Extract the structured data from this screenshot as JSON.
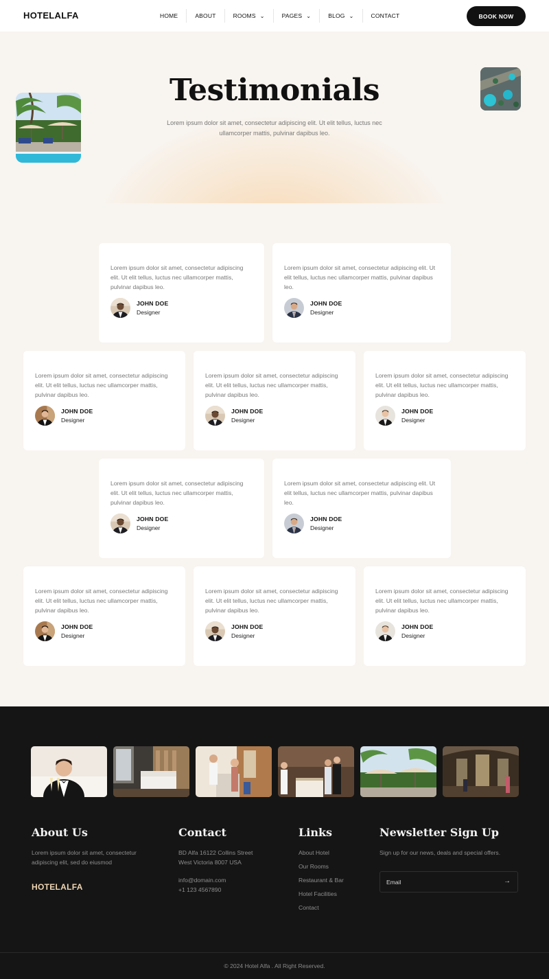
{
  "header": {
    "logo": "HOTELALFA",
    "nav": [
      {
        "label": "HOME",
        "dropdown": false
      },
      {
        "label": "ABOUT",
        "dropdown": false
      },
      {
        "label": "ROOMS",
        "dropdown": true
      },
      {
        "label": "PAGES",
        "dropdown": true
      },
      {
        "label": "BLOG",
        "dropdown": true
      },
      {
        "label": "CONTACT",
        "dropdown": false
      }
    ],
    "book_button": "BOOK NOW"
  },
  "hero": {
    "title": "Testimonials",
    "subtitle": "Lorem ipsum dolor sit amet, consectetur adipiscing elit. Ut elit tellus, luctus nec ullamcorper mattis, pulvinar dapibus leo."
  },
  "testimonials": [
    {
      "text": "Lorem ipsum dolor sit amet, consectetur adipiscing elit. Ut elit tellus, luctus nec ullamcorper mattis, pulvinar dapibus leo.",
      "name": "JOHN DOE",
      "role": "Designer"
    },
    {
      "text": "Lorem ipsum dolor sit amet, consectetur adipiscing elit. Ut elit tellus, luctus nec ullamcorper mattis, pulvinar dapibus leo.",
      "name": "JOHN DOE",
      "role": "Designer"
    },
    {
      "text": "Lorem ipsum dolor sit amet, consectetur adipiscing elit. Ut elit tellus, luctus nec ullamcorper mattis, pulvinar dapibus leo.",
      "name": "JOHN DOE",
      "role": "Designer"
    },
    {
      "text": "Lorem ipsum dolor sit amet, consectetur adipiscing elit. Ut elit tellus, luctus nec ullamcorper mattis, pulvinar dapibus leo.",
      "name": "JOHN DOE",
      "role": "Designer"
    },
    {
      "text": "Lorem ipsum dolor sit amet, consectetur adipiscing elit. Ut elit tellus, luctus nec ullamcorper mattis, pulvinar dapibus leo.",
      "name": "JOHN DOE",
      "role": "Designer"
    },
    {
      "text": "Lorem ipsum dolor sit amet, consectetur adipiscing elit. Ut elit tellus, luctus nec ullamcorper mattis, pulvinar dapibus leo.",
      "name": "JOHN DOE",
      "role": "Designer"
    },
    {
      "text": "Lorem ipsum dolor sit amet, consectetur adipiscing elit. Ut elit tellus, luctus nec ullamcorper mattis, pulvinar dapibus leo.",
      "name": "JOHN DOE",
      "role": "Designer"
    },
    {
      "text": "Lorem ipsum dolor sit amet, consectetur adipiscing elit. Ut elit tellus, luctus nec ullamcorper mattis, pulvinar dapibus leo.",
      "name": "JOHN DOE",
      "role": "Designer"
    },
    {
      "text": "Lorem ipsum dolor sit amet, consectetur adipiscing elit. Ut elit tellus, luctus nec ullamcorper mattis, pulvinar dapibus leo.",
      "name": "JOHN DOE",
      "role": "Designer"
    },
    {
      "text": "Lorem ipsum dolor sit amet, consectetur adipiscing elit. Ut elit tellus, luctus nec ullamcorper mattis, pulvinar dapibus leo.",
      "name": "JOHN DOE",
      "role": "Designer"
    }
  ],
  "footer": {
    "about": {
      "heading": "About Us",
      "text": "Lorem ipsum dolor sit amet, consectetur adipiscing elit, sed do eiusmod",
      "logo": "HOTELALFA"
    },
    "contact": {
      "heading": "Contact",
      "address_line1": "BD Alfa 16122 Collins Street",
      "address_line2": "West Victoria 8007 USA",
      "email": "info@domain.com",
      "phone": "+1 123 4567890"
    },
    "links": {
      "heading": "Links",
      "items": [
        "About Hotel",
        "Our Rooms",
        "Restaurant & Bar",
        "Hotel Facilities",
        "Contact"
      ]
    },
    "newsletter": {
      "heading": "Newsletter Sign Up",
      "text": "Sign up for our news, deals and special offers.",
      "placeholder": "Email"
    },
    "copyright": "© 2024 Hotel Alfa . All Right Reserved."
  },
  "colors": {
    "page_bg": "#f8f4ef",
    "dark": "#111111",
    "footer_bg": "#151515",
    "accent_glow": "#f7d1a4",
    "footer_logo": "#f0d6b4"
  }
}
